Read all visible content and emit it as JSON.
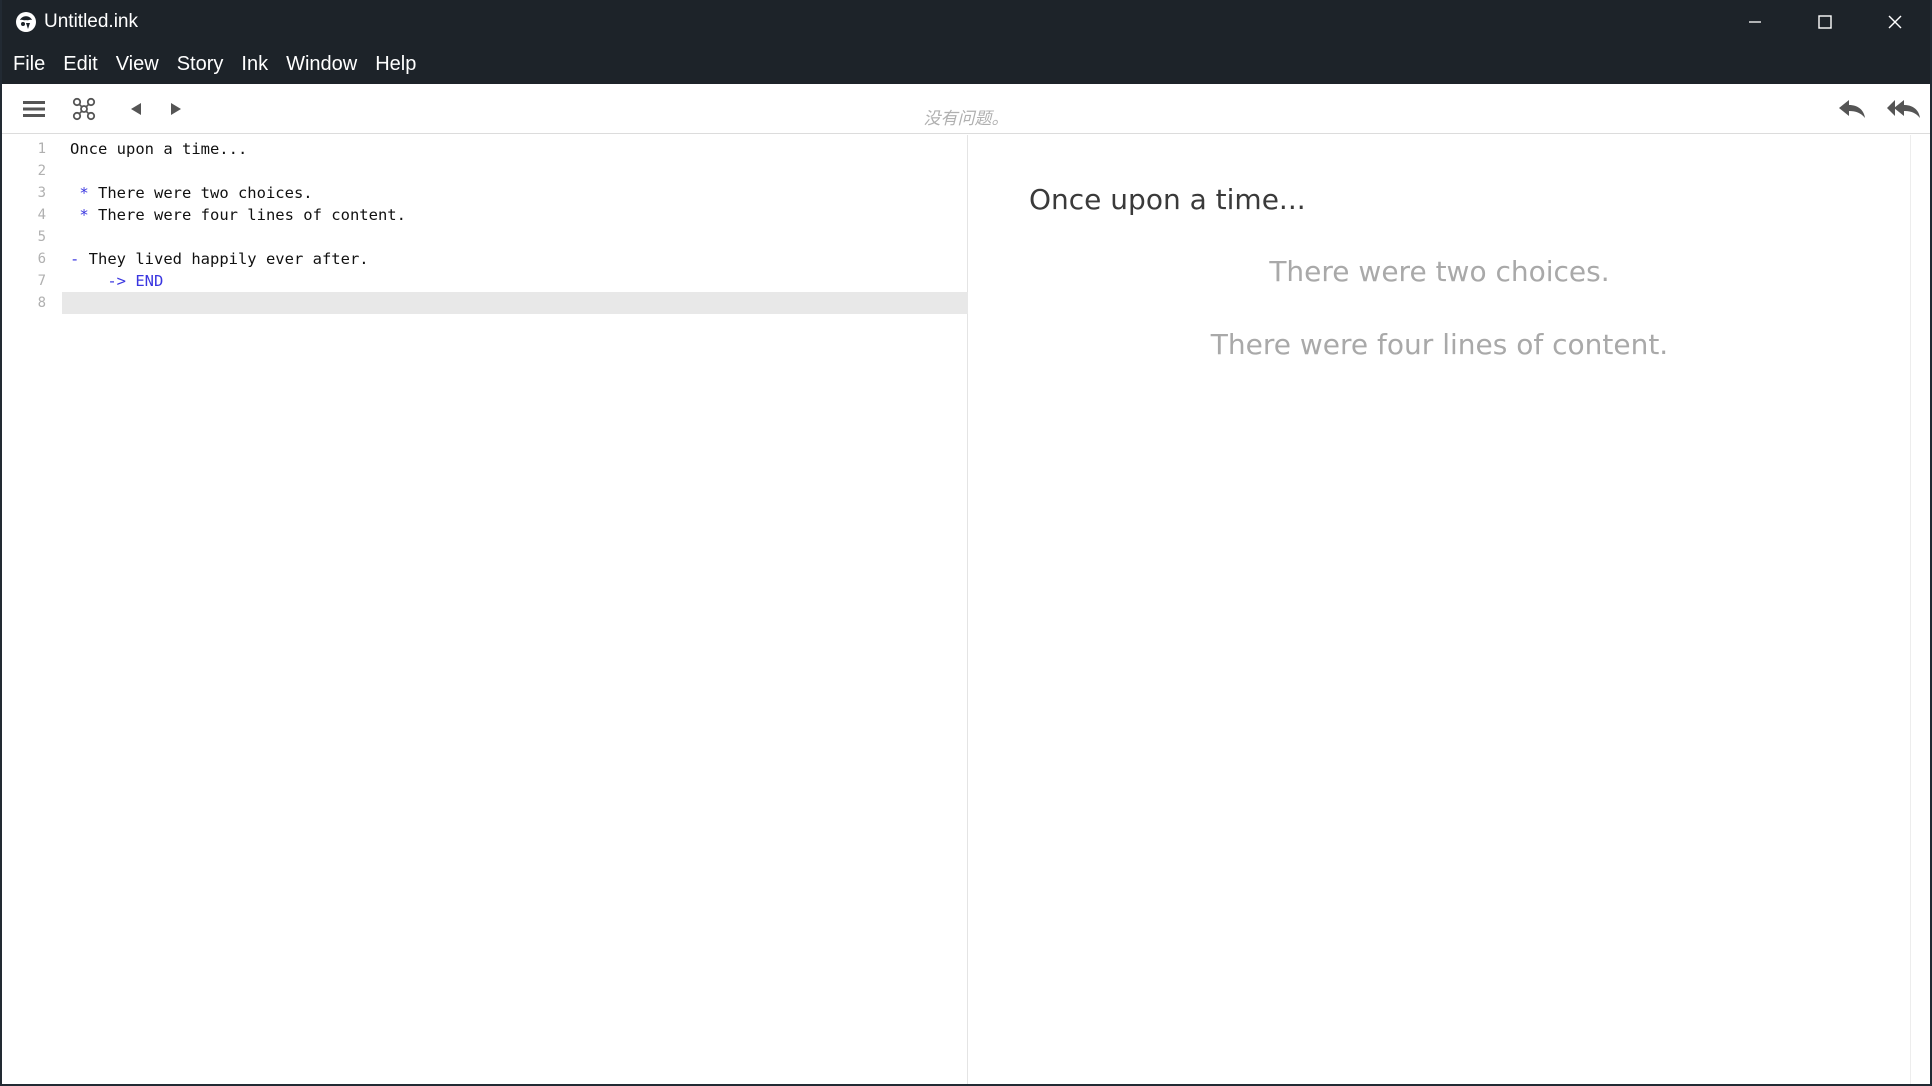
{
  "window": {
    "title": "Untitled.ink",
    "controls": [
      "minimize",
      "maximize",
      "close"
    ]
  },
  "menu": {
    "items": [
      "File",
      "Edit",
      "View",
      "Story",
      "Ink",
      "Window",
      "Help"
    ]
  },
  "toolbar": {
    "status": "没有问题。",
    "icons": [
      "menu-icon",
      "knot-navigator-icon",
      "back-arrow-icon",
      "forward-arrow-icon",
      "rewind-one-icon",
      "rewind-all-icon"
    ]
  },
  "editor": {
    "lines": [
      {
        "num": "1",
        "segments": [
          {
            "text": "Once upon a time...",
            "style": "plain"
          }
        ]
      },
      {
        "num": "2",
        "segments": []
      },
      {
        "num": "3",
        "segments": [
          {
            "text": " * ",
            "style": "blue"
          },
          {
            "text": "There were two choices.",
            "style": "plain"
          }
        ]
      },
      {
        "num": "4",
        "segments": [
          {
            "text": " * ",
            "style": "blue"
          },
          {
            "text": "There were four lines of content.",
            "style": "plain"
          }
        ]
      },
      {
        "num": "5",
        "segments": []
      },
      {
        "num": "6",
        "segments": [
          {
            "text": "- ",
            "style": "blue"
          },
          {
            "text": "They lived happily ever after.",
            "style": "plain"
          }
        ]
      },
      {
        "num": "7",
        "segments": [
          {
            "text": "    -> END",
            "style": "blue"
          }
        ]
      },
      {
        "num": "8",
        "segments": [],
        "active": true
      }
    ]
  },
  "player": {
    "story_text": "Once upon a time...",
    "choices": [
      "There were two choices.",
      "There were four lines of content."
    ]
  },
  "colors": {
    "titlebar": "#1d2329",
    "keyword_blue": "#3a36e0",
    "choice_gray": "#a9a9a9",
    "active_line": "#e8e8e8"
  }
}
